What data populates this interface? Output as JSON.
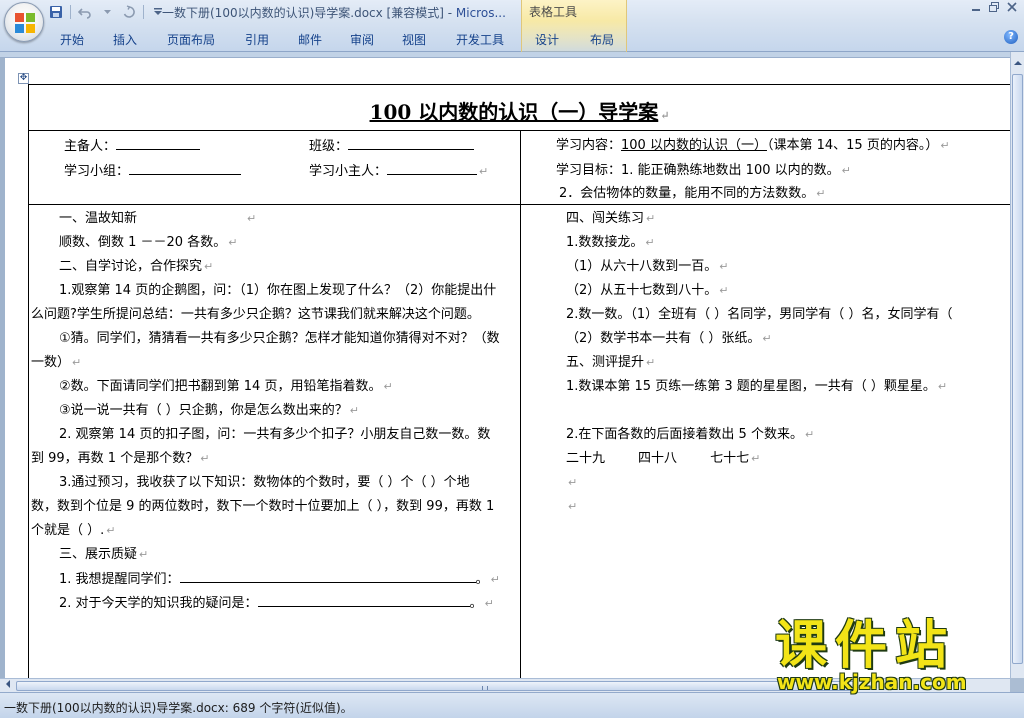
{
  "window": {
    "doc_title": "一数下册(100以内数的认识)导学案.docx [兼容模式] - ",
    "app_name": "Micros...",
    "context_group": "表格工具"
  },
  "ribbon": {
    "tabs": [
      "开始",
      "插入",
      "页面布局",
      "引用",
      "邮件",
      "审阅",
      "视图",
      "开发工具",
      "设计",
      "布局"
    ]
  },
  "icons": {
    "office_button": "office-logo-icon",
    "save": "save-icon",
    "undo": "undo-icon",
    "redo": "redo-icon",
    "customize": "dropdown-arrow-icon",
    "help": "help-icon",
    "table_move": "move-handle-icon"
  },
  "colors": {
    "tab_text": "#15428b",
    "context_group": "#f7e9a6",
    "watermark": "#f2e417"
  },
  "document": {
    "title_main": "100 以内数的认识（一）导学案",
    "header_left": {
      "preparer_label": "主备人：",
      "class_label": "班级：",
      "group_label": "学习小组：",
      "host_label": "学习小主人："
    },
    "header_right": {
      "content_label": "学习内容：",
      "content_value": "100 以内数的认识（一）",
      "content_note": "（课本第 14、15 页的内容。）",
      "goal_line1": "学习目标：1.  能正确熟练地数出 100 以内的数。",
      "goal_line2": "2．会估物体的数量，能用不同的方法数数。"
    },
    "left_lines": [
      "一、温故知新",
      "顺数、倒数 1 －－20 各数。",
      "二、自学讨论，合作探究",
      "1.观察第 14 页的企鹅图，问：（1）你在图上发现了什么？（2）你能提出什",
      "么问题?学生所提问总结：一共有多少只企鹅？这节课我们就来解决这个问题。",
      "①猜。同学们，猜猜看一共有多少只企鹅？怎样才能知道你猜得对不对？（数",
      "一数）",
      "②数。下面请同学们把书翻到第 14 页，用铅笔指着数。",
      "③说一说一共有（   ）只企鹅，你是怎么数出来的？",
      "2. 观察第 14 页的扣子图，问：一共有多少个扣子？小朋友自己数一数。数",
      "到 99，再数 1 个是那个数？",
      "3.通过预习，我收获了以下知识：数物体的个数时，要（   ）个（   ）个地",
      "数，数到个位是 9 的两位数时，数下一个数时十位要加上（   ），数到 99，再数 1",
      "个就是（   ）.",
      "三、展示质疑",
      "1. 我想提醒同学们：",
      "2. 对于今天学的知识我的疑问是："
    ],
    "right_lines": [
      "四、闯关练习",
      "1.数数接龙。",
      "（1）从六十八数到一百。",
      "（2）从五十七数到八十。",
      "2.数一数。（1）全班有（   ）名同学，男同学有（   ）名，女同学有（",
      "（2）数学书本一共有（   ）张纸。",
      "五、测评提升",
      "1.数课本第 15 页练一练第 3 题的星星图，一共有（   ）颗星星。",
      "",
      "2.在下面各数的后面接着数出 5 个数来。",
      "二十九        四十八        七十七"
    ],
    "paragraph_mark": "↵"
  },
  "status_bar": {
    "text": "一数下册(100以内数的认识)导学案.docx: 689 个字符(近似值)。"
  },
  "watermark": {
    "main": "课件站",
    "url": "www.kjzhan.com"
  }
}
